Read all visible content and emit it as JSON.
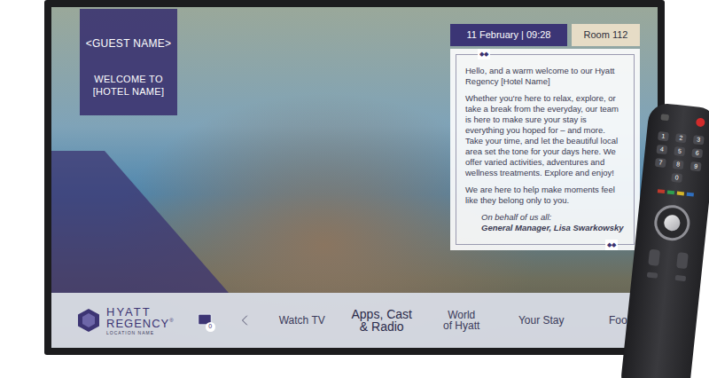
{
  "screen": {
    "welcome": {
      "guest": "<GUEST NAME>",
      "line1": "WELCOME TO",
      "line2": "[HOTEL NAME]"
    },
    "datetime": "11 February | 09:28",
    "room": "Room 112",
    "message": {
      "ornament": "◆◆",
      "paragraphs": [
        "Hello, and a warm welcome to our Hyatt Regency [Hotel Name]",
        "Whether you're here to relax, explore, or take a break from the everyday, our team is here to make sure your stay is everything you hoped for – and more. Take your time, and let the beautiful local area set the tone for your days here.  We offer varied activities, adventures and wellness treatments. Explore and enjoy!",
        "We are here to help make moments feel like they belong only to you."
      ],
      "signoff": "On behalf of us all:",
      "signature": "General Manager, Lisa Swarkowsky"
    },
    "nav": {
      "logo": {
        "brand": "HYATT",
        "sub": "REGENCY",
        "registered": "®",
        "location": "LOCATION NAME"
      },
      "mail_count": "0",
      "items": [
        {
          "label": "Watch TV",
          "selected": false
        },
        {
          "label": "Apps, Cast\n& Radio",
          "selected": true
        },
        {
          "label": "World\nof Hyatt",
          "selected": false
        },
        {
          "label": "Your Stay",
          "selected": false
        },
        {
          "label": "Food",
          "selected": false
        }
      ]
    }
  },
  "remote": {
    "keys": [
      "1",
      "2",
      "3",
      "4",
      "5",
      "6",
      "7",
      "8",
      "9",
      "0"
    ]
  }
}
